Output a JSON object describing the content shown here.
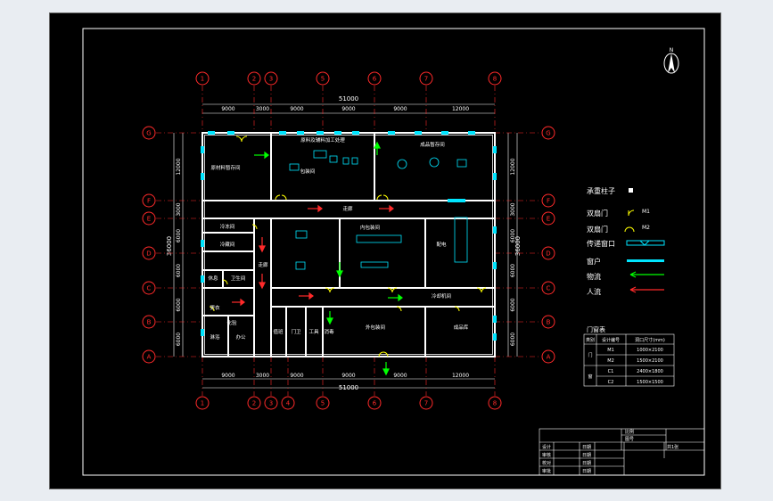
{
  "colors": {
    "background": "#000000",
    "frame": "#ffffff",
    "wall": "#ffffff",
    "grid_axis": "#ff2a2a",
    "dimension": "#ffffff",
    "window": "#00e5ff",
    "column": "#00e5ff",
    "door": "#ffff00",
    "logistics_flow": "#00ff00",
    "people_flow": "#ff2a2a",
    "text": "#ffffff"
  },
  "north_label": "N",
  "axes": {
    "vertical": [
      "1",
      "2",
      "3",
      "5",
      "6",
      "7",
      "8"
    ],
    "vertical_bottom": [
      "1",
      "2",
      "3",
      "4",
      "5",
      "6",
      "7",
      "8"
    ],
    "horizontal": [
      "G",
      "F",
      "E",
      "D",
      "C",
      "B",
      "A"
    ]
  },
  "dims": {
    "top_total": "51000",
    "top_spans": [
      "9000",
      "3000",
      "9000",
      "9000",
      "9000",
      "12000"
    ],
    "bottom_spans": [
      "9000",
      "3000",
      "9000",
      "9000",
      "9000",
      "12000"
    ],
    "bottom_total": "51000",
    "left_outer": "36000",
    "left_spans": [
      "12000",
      "3000",
      "6000",
      "6000",
      "6000",
      "6000"
    ],
    "right_outer": "36000",
    "right_spans": [
      "12000",
      "3000",
      "6000",
      "6000",
      "6000",
      "6000"
    ]
  },
  "rooms": {
    "raw_storage": "原材料暂存间",
    "material_processing": "原料及辅料加工处理",
    "finished_storage": "成品暂存间",
    "cooling": "冷却机间",
    "storage_a": "冷冻间",
    "storage_b": "冷藏间",
    "rest": "休息",
    "toilet": "卫生间",
    "locker": "更衣",
    "shower": "淋浴",
    "office": "办公",
    "lab": "化验",
    "corridor_main": "走廊",
    "corridor_side": "走廊",
    "shop_left": "包装间",
    "shop_mid": "外包装间",
    "shop_right": "成品库",
    "inner_room": "内包装间",
    "side_room": "配电",
    "bottom_room1": "值班",
    "bottom_room2": "门卫",
    "bottom_room3": "工具",
    "bottom_room4": "消毒"
  },
  "doors": [
    "M1",
    "M2",
    "M2",
    "M1",
    "C2",
    "C1"
  ],
  "legend": {
    "column_label": "承重柱子",
    "door_single_label": "双扇门",
    "door_single_code": "M1",
    "door_double_label": "双扇门",
    "door_double_code": "M2",
    "pass_window_label": "传递窗口",
    "window_label": "窗户",
    "logistics_label": "物流",
    "people_label": "人流"
  },
  "door_table": {
    "title": "门窗表",
    "headers": [
      "类别",
      "设计编号",
      "洞口尺寸(mm)"
    ],
    "rows": [
      {
        "category": "门",
        "code": "M1",
        "size": "1000×2100"
      },
      {
        "category": "",
        "code": "M2",
        "size": "1500×2100"
      },
      {
        "category": "窗",
        "code": "C1",
        "size": "2400×1800"
      },
      {
        "category": "",
        "code": "C2",
        "size": "1500×1500"
      }
    ]
  },
  "title_block": {
    "r1": [
      "",
      "",
      "比例"
    ],
    "r2": [
      "",
      "",
      "图号"
    ],
    "r3": [
      "设计",
      "日期",
      "",
      "共1张"
    ],
    "r4": [
      "审核",
      "日期"
    ],
    "r5": [
      "校对",
      "日期"
    ],
    "r6": [
      "审批",
      "日期"
    ]
  }
}
